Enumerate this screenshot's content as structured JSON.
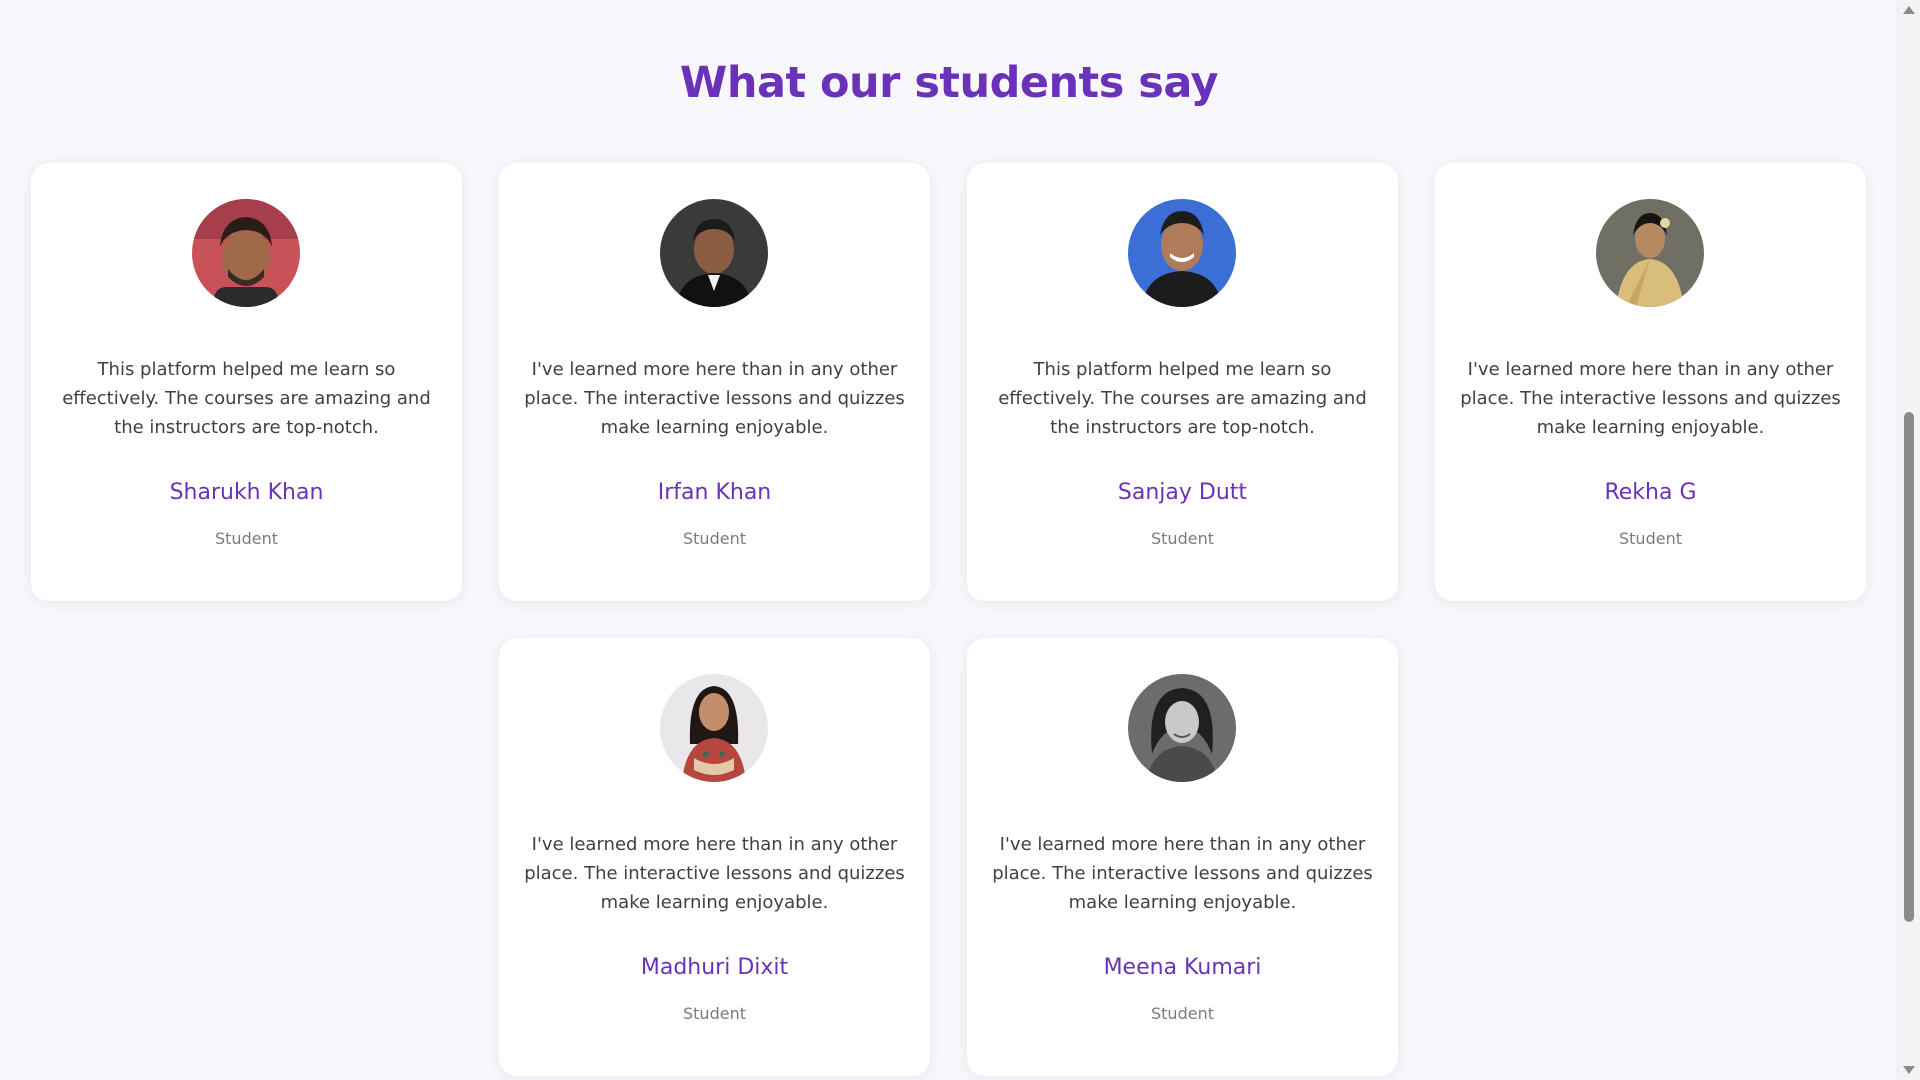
{
  "section": {
    "title": "What our students say"
  },
  "testimonials": [
    {
      "quote": "This platform helped me learn so effectively. The courses are amazing and the instructors are top-notch.",
      "name": "Sharukh Khan",
      "role": "Student",
      "avatar_colors": {
        "bg": "#c9515a",
        "skin": "#a06a4a",
        "hair": "#2a1d17",
        "clothes": "#2b2b2b"
      }
    },
    {
      "quote": "I've learned more here than in any other place. The interactive lessons and quizzes make learning enjoyable.",
      "name": "Irfan Khan",
      "role": "Student",
      "avatar_colors": {
        "bg": "#3a3a3a",
        "skin": "#8b5e43",
        "hair": "#1b1b1b",
        "clothes": "#111111"
      }
    },
    {
      "quote": "This platform helped me learn so effectively. The courses are amazing and the instructors are top-notch.",
      "name": "Sanjay Dutt",
      "role": "Student",
      "avatar_colors": {
        "bg": "#3b6fd6",
        "skin": "#b07b5a",
        "hair": "#1d1d1d",
        "clothes": "#1c1c1c"
      }
    },
    {
      "quote": "I've learned more here than in any other place. The interactive lessons and quizzes make learning enjoyable.",
      "name": "Rekha G",
      "role": "Student",
      "avatar_colors": {
        "bg": "#6f6f64",
        "skin": "#b58a62",
        "hair": "#171513",
        "clothes": "#d9bd7a"
      }
    },
    {
      "quote": "I've learned more here than in any other place. The interactive lessons and quizzes make learning enjoyable.",
      "name": "Madhuri Dixit",
      "role": "Student",
      "avatar_colors": {
        "bg": "#e9e7ea",
        "skin": "#c48e6d",
        "hair": "#201714",
        "clothes": "#b6473f"
      }
    },
    {
      "quote": "I've learned more here than in any other place. The interactive lessons and quizzes make learning enjoyable.",
      "name": "Meena Kumari",
      "role": "Student",
      "avatar_colors": {
        "bg": "#6c6c6c",
        "skin": "#c9c9c9",
        "hair": "#202020",
        "clothes": "#4a4a4a"
      }
    }
  ],
  "colors": {
    "accent": "#6a32b8",
    "page_bg": "#f8f7fb",
    "card_bg": "#ffffff",
    "text": "#3f3f46",
    "muted": "#7b7b85"
  }
}
